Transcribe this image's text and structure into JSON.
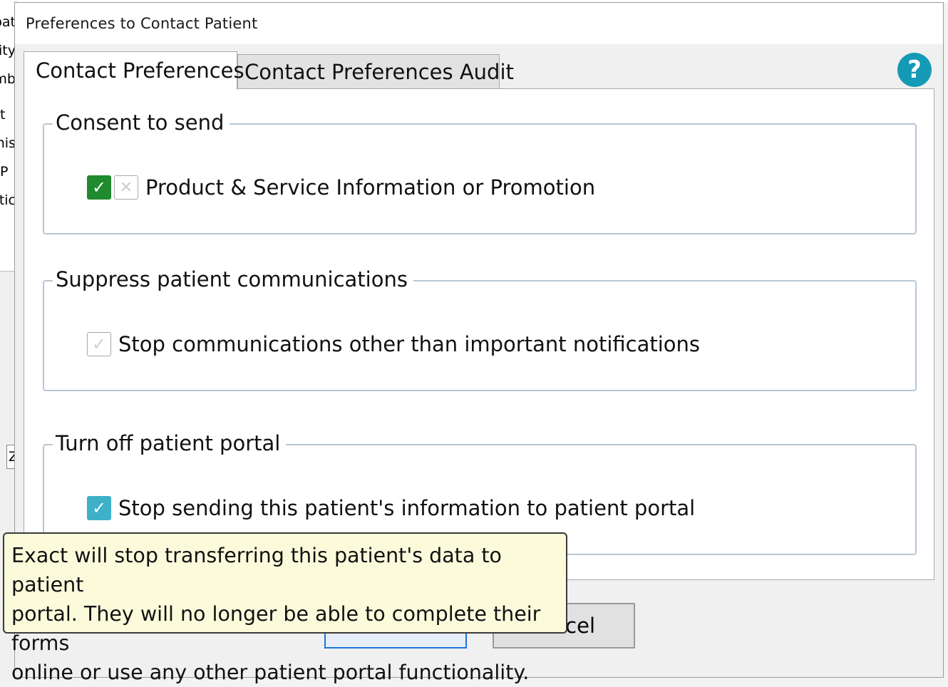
{
  "background_fragments": [
    "pat",
    "ity",
    "mb",
    "t",
    "nis",
    "P",
    "tic",
    "Z"
  ],
  "dialog": {
    "title": "Preferences to Contact Patient"
  },
  "tabs": [
    {
      "label": "Contact Preferences",
      "active": true
    },
    {
      "label": "Contact Preferences Audit",
      "active": false
    }
  ],
  "help": {
    "icon": "question-mark-icon",
    "glyph": "?",
    "color": "#159ab6"
  },
  "groups": [
    {
      "legend": "Consent to send",
      "option": {
        "label": "Product & Service Information or Promotion",
        "state": "consented",
        "icons": [
          "check-icon",
          "cross-icon"
        ],
        "glyphs": [
          "✓",
          "✕"
        ]
      }
    },
    {
      "legend": "Suppress patient communications",
      "option": {
        "label": "Stop communications other than important notifications",
        "checked": false,
        "glyph": "✓"
      }
    },
    {
      "legend": "Turn off patient portal",
      "option": {
        "label": "Stop sending this patient's information to patient portal",
        "checked": true,
        "glyph": "✓"
      }
    }
  ],
  "buttons": {
    "ok": "",
    "cancel": "cel"
  },
  "tooltip": {
    "lines": [
      "Exact will stop transferring this patient's data to patient",
      "portal. They will no longer be able to complete their forms",
      "online or use any other patient portal functionality."
    ]
  },
  "colors": {
    "consent_check": "#1f8a2e",
    "checked_box": "#3db1c8",
    "tooltip_bg": "#fbfbdc",
    "focus_border": "#1e73d6"
  }
}
